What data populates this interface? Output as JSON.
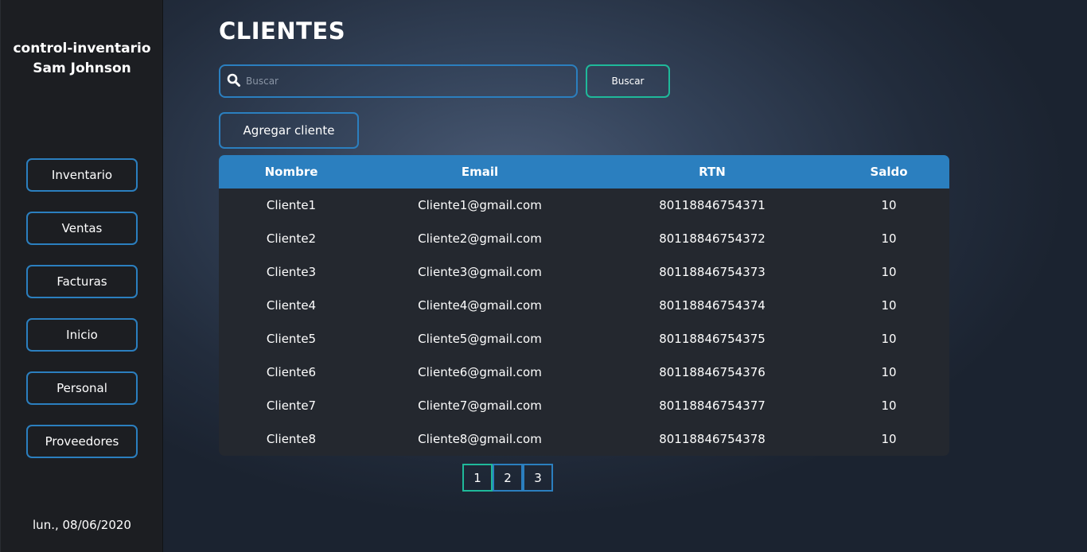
{
  "sidebar": {
    "app_name": "control-inventario",
    "user_name": "Sam Johnson",
    "items": [
      {
        "label": "Inventario"
      },
      {
        "label": "Ventas"
      },
      {
        "label": "Facturas"
      },
      {
        "label": "Inicio"
      },
      {
        "label": "Personal"
      },
      {
        "label": "Proveedores"
      }
    ],
    "date": "lun., 08/06/2020"
  },
  "main": {
    "title": "CLIENTES",
    "search": {
      "placeholder": "Buscar",
      "value": "",
      "button_label": "Buscar",
      "icon": "search-icon"
    },
    "add_button_label": "Agregar cliente",
    "table": {
      "columns": [
        "Nombre",
        "Email",
        "RTN",
        "Saldo"
      ],
      "rows": [
        [
          "Cliente1",
          "Cliente1@gmail.com",
          "80118846754371",
          "10"
        ],
        [
          "Cliente2",
          "Cliente2@gmail.com",
          "80118846754372",
          "10"
        ],
        [
          "Cliente3",
          "Cliente3@gmail.com",
          "80118846754373",
          "10"
        ],
        [
          "Cliente4",
          "Cliente4@gmail.com",
          "80118846754374",
          "10"
        ],
        [
          "Cliente5",
          "Cliente5@gmail.com",
          "80118846754375",
          "10"
        ],
        [
          "Cliente6",
          "Cliente6@gmail.com",
          "80118846754376",
          "10"
        ],
        [
          "Cliente7",
          "Cliente7@gmail.com",
          "80118846754377",
          "10"
        ],
        [
          "Cliente8",
          "Cliente8@gmail.com",
          "80118846754378",
          "10"
        ]
      ]
    },
    "pagination": {
      "pages": [
        "1",
        "2",
        "3"
      ],
      "current": "1"
    }
  },
  "colors": {
    "accent_blue": "#2b7fbf",
    "accent_green": "#1fb99a",
    "sidebar_bg": "#1c1e22",
    "table_bg": "#24282f"
  }
}
